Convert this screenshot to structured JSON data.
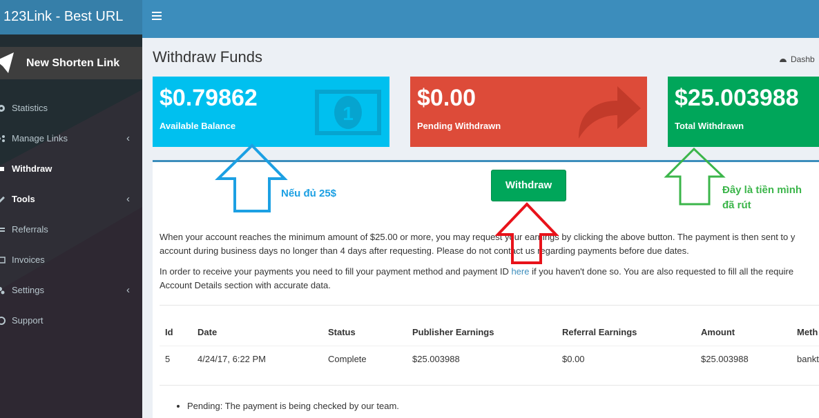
{
  "app": {
    "title": "123Link - Best URL"
  },
  "sidebar": {
    "new_shorten_label": "New Shorten Link",
    "items": [
      {
        "label": "Statistics",
        "icon": "dashboard-icon",
        "has_children": false
      },
      {
        "label": "Manage Links",
        "icon": "share-icon",
        "has_children": true
      },
      {
        "label": "Withdraw",
        "icon": "dollar-icon",
        "has_children": false,
        "active": true
      },
      {
        "label": "Tools",
        "icon": "wrench-icon",
        "has_children": true
      },
      {
        "label": "Referrals",
        "icon": "exchange-icon",
        "has_children": false
      },
      {
        "label": "Invoices",
        "icon": "credit-card-icon",
        "has_children": false
      },
      {
        "label": "Settings",
        "icon": "gears-icon",
        "has_children": true
      },
      {
        "label": "Support",
        "icon": "life-ring-icon",
        "has_children": false
      }
    ]
  },
  "page": {
    "title": "Withdraw Funds",
    "breadcrumb": "Dashb"
  },
  "stats": {
    "available": {
      "value": "$0.79862",
      "label": "Available Balance",
      "color": "#00c0ef"
    },
    "pending": {
      "value": "$0.00",
      "label": "Pending Withdrawn",
      "color": "#dd4b39"
    },
    "total": {
      "value": "$25.003988",
      "label": "Total Withdrawn",
      "color": "#00a65a"
    }
  },
  "withdraw_button": "Withdraw",
  "text": {
    "para1_line1": "When your account reaches the minimum amount of $25.00 or more, you may request your earnings by clicking the above button. The payment is then sent to y",
    "para1_line2": "account during business days no longer than 4 days after requesting. Please do not contact us regarding payments before due dates.",
    "para2_line1_before": "In order to receive your payments you need to fill your payment method and payment ID ",
    "para2_link": "here",
    "para2_line1_after": " if you haven't done so. You are also requested to fill all the require",
    "para2_line2": "Account Details section with accurate data."
  },
  "table": {
    "headers": [
      "Id",
      "Date",
      "Status",
      "Publisher Earnings",
      "Referral Earnings",
      "Amount",
      "Meth"
    ],
    "rows": [
      {
        "id": "5",
        "date": "4/24/17, 6:22 PM",
        "status": "Complete",
        "publisher": "$25.003988",
        "referral": "$0.00",
        "amount": "$25.003988",
        "method": "bankt"
      }
    ]
  },
  "notes": [
    "Pending: The payment is being checked by our team."
  ],
  "annotations": {
    "blue": "Nếu đủ 25$",
    "green_line1": "Đây là tiền mình",
    "green_line2": "đã rút"
  },
  "colors": {
    "topbar": "#3c8dbc",
    "sidebar": "#222d32",
    "arrow_blue": "#1ca0e3",
    "arrow_red": "#e8121a",
    "arrow_green": "#3bb54a"
  }
}
